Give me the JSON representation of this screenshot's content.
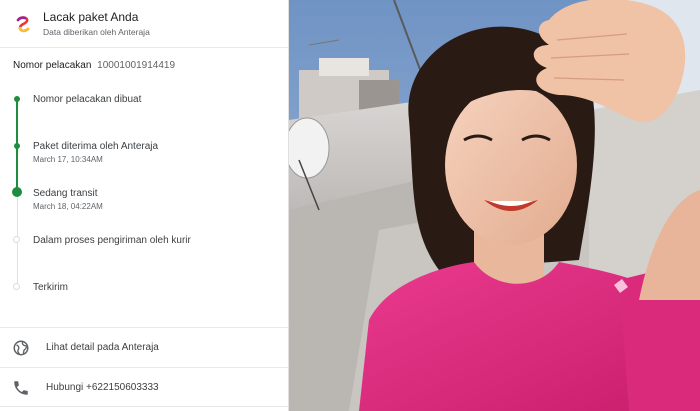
{
  "header": {
    "title": "Lacak paket Anda",
    "subtitle": "Data diberikan oleh Anteraja",
    "logo_icon": "anteraja-logo-icon"
  },
  "tracking": {
    "label": "Nomor pelacakan",
    "number": "10001001914419"
  },
  "timeline": {
    "steps": [
      {
        "title": "Nomor pelacakan dibuat",
        "date": "",
        "status": "done"
      },
      {
        "title": "Paket diterima oleh Anteraja",
        "date": "March 17, 10:34AM",
        "status": "done"
      },
      {
        "title": "Sedang transit",
        "date": "March 18, 04:22AM",
        "status": "current"
      },
      {
        "title": "Dalam proses pengiriman oleh kurir",
        "date": "",
        "status": "pending"
      },
      {
        "title": "Terkirim",
        "date": "",
        "status": "pending"
      }
    ]
  },
  "actions": {
    "details_label": "Lihat detail pada Anteraja",
    "details_icon": "globe-icon",
    "call_label": "Hubungi +622150603333",
    "call_icon": "phone-icon"
  },
  "colors": {
    "accent_green": "#1e8e3e",
    "shirt_pink": "#e0277f",
    "sky_blue": "#7fa0c8"
  }
}
